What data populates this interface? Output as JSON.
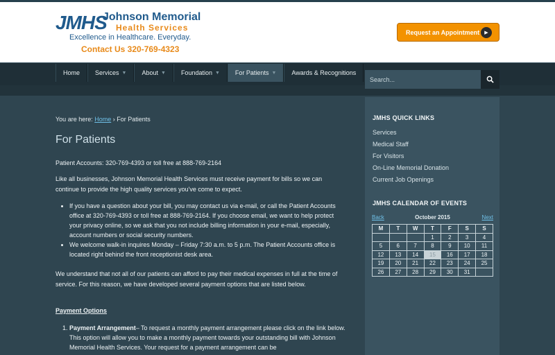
{
  "header": {
    "logo_text": "JMHS",
    "org_name": "Johnson Memorial",
    "org_sub": "Health Services",
    "tagline": "Excellence in Healthcare. Everyday.",
    "contact": "Contact Us 320-769-4323",
    "appointment_button": "Request an Appointment"
  },
  "nav": {
    "items": [
      {
        "label": "Home",
        "has_arrow": false
      },
      {
        "label": "Services",
        "has_arrow": true
      },
      {
        "label": "About",
        "has_arrow": true
      },
      {
        "label": "Foundation",
        "has_arrow": true
      },
      {
        "label": "For Patients",
        "has_arrow": true,
        "active": true
      },
      {
        "label": "Awards & Recognitions",
        "has_arrow": false
      }
    ],
    "search_placeholder": "Search..."
  },
  "breadcrumb": {
    "prefix": "You are here:",
    "home": "Home",
    "separator": "›",
    "current": "For Patients"
  },
  "main": {
    "title": "For Patients",
    "accounts_line": "Patient Accounts: 320-769-4393 or toll free at 888-769-2164",
    "intro": "Like all businesses, Johnson Memorial Health Services must receive payment for bills so we can continue to provide the high quality services you've come to expect.",
    "bullet1_pre": "If you have a question about your bill, you may contact us via ",
    "bullet1_link": "e-mail",
    "bullet1_post": ", or call the Patient Accounts office at 320-769-4393 or toll free at 888-769-2164.  If you choose email, we want to help protect your privacy online, so we ask that you not include billing information in your e-mail, especially, account numbers or social security numbers.",
    "bullet2": "We welcome walk-in inquires Monday – Friday 7:30 a.m. to 5 p.m.  The Patient Accounts office is located right behind the front receptionist desk area.",
    "understand": "We understand that not all of our patients can afford to pay their medical expenses in full at the time of service.  For this reason, we have developed several payment options that are listed below.",
    "payment_heading": "Payment Options",
    "option1_title": "Payment Arrangement",
    "option1_text": "– To request a monthly payment arrangement please click on the link below.  This option will allow you to make a monthly payment towards your outstanding bill with Johnson Memorial Health Services.  Your request for a payment arrangement can be"
  },
  "sidebar": {
    "quick_links_title": "JMHS QUICK LINKS",
    "quick_links": [
      "Services",
      "Medical Staff",
      "For Visitors",
      "On-Line Memorial Donation",
      "Current Job Openings"
    ],
    "calendar_title": "JMHS CALENDAR OF EVENTS",
    "calendar": {
      "prev": "Back",
      "next": "Next",
      "month": "October  2015",
      "weekdays": [
        "M",
        "T",
        "W",
        "T",
        "F",
        "S",
        "S"
      ],
      "weeks": [
        [
          "",
          "",
          "",
          "1",
          "2",
          "3",
          "4"
        ],
        [
          "5",
          "6",
          "7",
          "8",
          "9",
          "10",
          "11"
        ],
        [
          "12",
          "13",
          "14",
          "15",
          "16",
          "17",
          "18"
        ],
        [
          "19",
          "20",
          "21",
          "22",
          "23",
          "24",
          "25"
        ],
        [
          "26",
          "27",
          "28",
          "29",
          "30",
          "31",
          ""
        ]
      ],
      "today": "15"
    }
  },
  "colors": {
    "accent_orange": "#f39200",
    "brand_blue": "#1f5a8c",
    "link_blue": "#6fc0e8",
    "body_bg": "#2f4550",
    "sidebar_bg": "#3a5360"
  }
}
